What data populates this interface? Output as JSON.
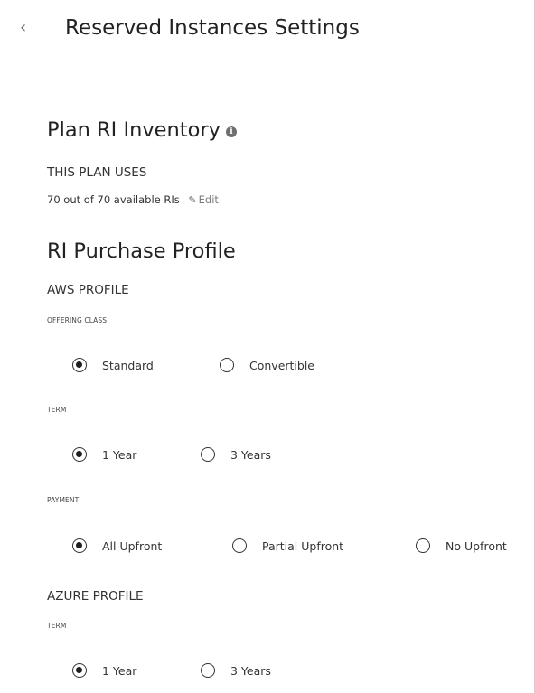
{
  "header": {
    "back_icon": "chevron-left-icon",
    "title": "Reserved Instances Settings"
  },
  "inventory": {
    "title": "Plan RI Inventory",
    "info_icon": "info-icon",
    "uses_label": "THIS PLAN USES",
    "summary": "70 out of 70 available RIs",
    "edit_label": "Edit",
    "edit_icon": "pencil-icon"
  },
  "purchase": {
    "title": "RI Purchase Profile",
    "aws": {
      "label": "AWS PROFILE",
      "offering": {
        "label": "OFFERING CLASS",
        "options": [
          {
            "label": "Standard",
            "checked": true
          },
          {
            "label": "Convertible",
            "checked": false
          }
        ]
      },
      "term": {
        "label": "TERM",
        "options": [
          {
            "label": "1 Year",
            "checked": true
          },
          {
            "label": "3 Years",
            "checked": false
          }
        ]
      },
      "payment": {
        "label": "PAYMENT",
        "options": [
          {
            "label": "All Upfront",
            "checked": true
          },
          {
            "label": "Partial Upfront",
            "checked": false
          },
          {
            "label": "No Upfront",
            "checked": false
          }
        ]
      }
    },
    "azure": {
      "label": "AZURE PROFILE",
      "term": {
        "label": "TERM",
        "options": [
          {
            "label": "1 Year",
            "checked": true
          },
          {
            "label": "3 Years",
            "checked": false
          }
        ]
      }
    }
  }
}
